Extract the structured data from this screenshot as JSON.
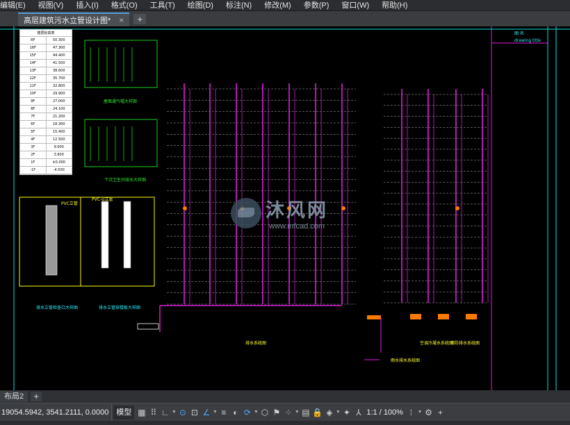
{
  "menu": [
    "编辑(E)",
    "视图(V)",
    "插入(I)",
    "格式(O)",
    "工具(T)",
    "绘图(D)",
    "标注(N)",
    "修改(M)",
    "参数(P)",
    "窗口(W)",
    "帮助(H)"
  ],
  "document_tab": {
    "title": "高层建筑污水立管设计图*",
    "close": "×",
    "add": "+"
  },
  "layout_tab": {
    "label": "布局2",
    "add": "+"
  },
  "status": {
    "coordinates": "19054.5942, 3541.2111, 0.0000",
    "model_label": "模型",
    "scale": "1:1 / 100%",
    "plus": "+"
  },
  "drawing": {
    "floor_table": {
      "header": "楼层标高表",
      "rows": [
        [
          "RF",
          "50.300"
        ],
        [
          "16F",
          "47.300"
        ],
        [
          "15F",
          "44.400"
        ],
        [
          "14F",
          "41.500"
        ],
        [
          "13F",
          "38.600"
        ],
        [
          "12F",
          "35.700"
        ],
        [
          "11F",
          "32.800"
        ],
        [
          "10F",
          "29.900"
        ],
        [
          "9F",
          "27.000"
        ],
        [
          "8F",
          "24.100"
        ],
        [
          "7F",
          "21.200"
        ],
        [
          "6F",
          "18.300"
        ],
        [
          "5F",
          "15.400"
        ],
        [
          "4F",
          "12.500"
        ],
        [
          "3F",
          "9.600"
        ],
        [
          "2F",
          "3.600"
        ],
        [
          "1F",
          "±0.000"
        ],
        [
          "-1F",
          "-4.500"
        ]
      ]
    },
    "detail_labels": [
      "屋面通气帽大样图",
      "下沉卫生间排水大样图",
      "排水立管检查口大样图",
      "排水立管穿楼板大样图"
    ],
    "pvc_labels": [
      "PVC立管",
      "PVC-U立管"
    ],
    "system_labels": [
      "排水系统图",
      "雨水排水系统图",
      "空调冷凝水系统图",
      "消防排水系统图"
    ],
    "title_block": {
      "label": "图 名",
      "sub": "drawing title"
    },
    "watermark": {
      "text": "沐风网",
      "url": "www.mfcad.com"
    },
    "colors": {
      "pipe": "#e020e0",
      "frame": "#00e5e5",
      "detail": "#1ed01e",
      "note": "#ffff00",
      "outlet": "#ff7a00"
    }
  },
  "icons": [
    "grid-icon",
    "snap-icon",
    "ortho-icon",
    "polar-icon",
    "osnap-icon",
    "otrack-icon",
    "lineweight-icon",
    "transparency-icon",
    "selection-cycling-icon",
    "3dosnap-icon",
    "annotation-monitor-icon",
    "units-icon",
    "quick-properties-icon",
    "lock-ui-icon",
    "isolate-icon",
    "workspace-icon",
    "annotation-scale-icon",
    "customize-icon",
    "gear-icon"
  ]
}
